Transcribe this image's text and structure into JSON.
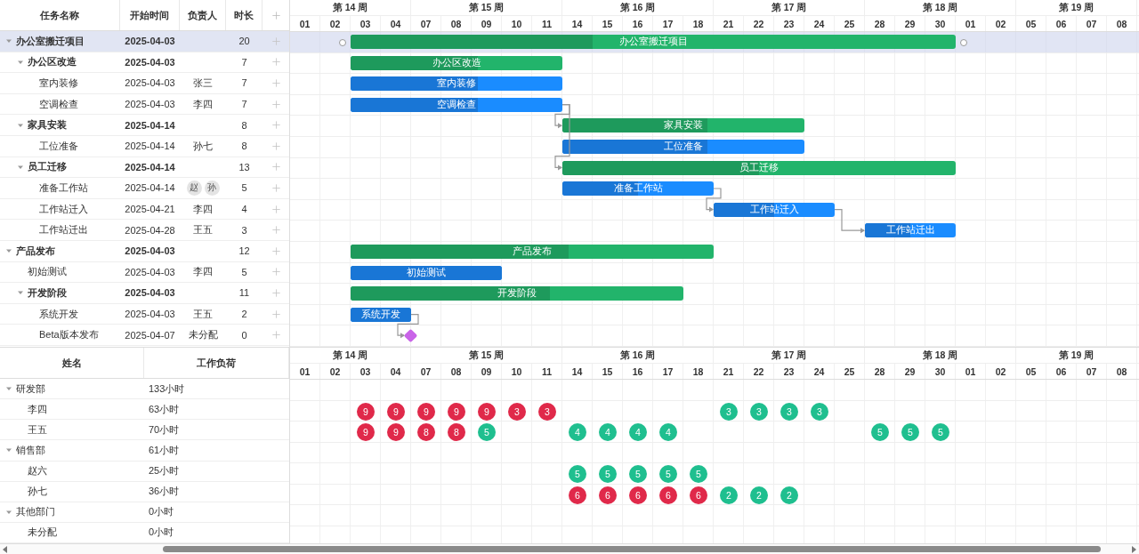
{
  "task_table": {
    "columns": [
      "任务名称",
      "开始时间",
      "负责人",
      "时长"
    ]
  },
  "timeline": {
    "weeks": [
      {
        "label": "第 14 周",
        "days": [
          "01",
          "02",
          "03",
          "04"
        ]
      },
      {
        "label": "第 15 周",
        "days": [
          "07",
          "08",
          "09",
          "10",
          "11"
        ]
      },
      {
        "label": "第 16 周",
        "days": [
          "14",
          "15",
          "16",
          "17",
          "18"
        ]
      },
      {
        "label": "第 17 周",
        "days": [
          "21",
          "22",
          "23",
          "24",
          "25"
        ]
      },
      {
        "label": "第 18 周",
        "days": [
          "28",
          "29",
          "30",
          "01",
          "02"
        ]
      },
      {
        "label": "第 19 周",
        "days": [
          "05",
          "06",
          "07",
          "08"
        ]
      }
    ]
  },
  "tasks": [
    {
      "name": "办公室搬迁项目",
      "start": "2025-04-03",
      "duration": "20",
      "bar_label": "办公室搬迁项目",
      "level": 0.4,
      "selected": true,
      "expanded": true,
      "children": [
        {
          "name": "办公区改造",
          "start": "2025-04-03",
          "duration": "7",
          "bar_label": "办公区改造",
          "level": 0.6,
          "selected": false,
          "expanded": true,
          "children": [
            {
              "name": "室内装修",
              "start": "2025-04-03",
              "assignee": "张三",
              "duration": "7",
              "bar_label": "室内装修",
              "level": 0.6,
              "selected": false
            },
            {
              "name": "空调检查",
              "start": "2025-04-03",
              "assignee": "李四",
              "duration": "7",
              "bar_label": "空调检查",
              "level": 0.6,
              "selected": false
            }
          ]
        },
        {
          "name": "家具安装",
          "start": "2025-04-14",
          "duration": "8",
          "bar_label": "家具安装",
          "level": 0.6,
          "selected": false,
          "expanded": true,
          "linked": true,
          "children": [
            {
              "name": "工位准备",
              "start": "2025-04-14",
              "assignee": "孙七",
              "duration": "8",
              "bar_label": "工位准备",
              "level": 0.6,
              "selected": false
            }
          ]
        },
        {
          "name": "员工迁移",
          "start": "2025-04-14",
          "duration": "13",
          "bar_label": "员工迁移",
          "level": 0.5,
          "selected": false,
          "expanded": true,
          "linked": true,
          "children": [
            {
              "name": "准备工作站",
              "start": "2025-04-14",
              "assignees": [
                "赵",
                "孙"
              ],
              "duration": "5",
              "bar_label": "准备工作站",
              "level": 0.5,
              "selected": false
            },
            {
              "name": "工作站迁入",
              "start": "2025-04-21",
              "assignee": "李四",
              "duration": "4",
              "bar_label": "工作站迁入",
              "level": 0.5,
              "selected": false,
              "linked": true
            },
            {
              "name": "工作站迁出",
              "start": "2025-04-28",
              "assignee": "王五",
              "duration": "3",
              "bar_label": "工作站迁出",
              "level": 0.5,
              "selected": false,
              "linked": true
            }
          ]
        }
      ]
    },
    {
      "name": "产品发布",
      "start": "2025-04-03",
      "duration": "12",
      "bar_label": "产品发布",
      "level": 0.6,
      "selected": false,
      "expanded": true,
      "children": [
        {
          "name": "初始测试",
          "start": "2025-04-03",
          "assignee": "李四",
          "duration": "5",
          "bar_label": "初始测试",
          "level": 1,
          "selected": false
        },
        {
          "name": "开发阶段",
          "start": "2025-04-03",
          "duration": "11",
          "bar_label": "开发阶段",
          "level": 0.6,
          "selected": false,
          "expanded": true,
          "children": [
            {
              "name": "系统开发",
              "start": "2025-04-03",
              "assignee": "王五",
              "duration": "2",
              "bar_label": "系统开发",
              "level": 1,
              "selected": false
            },
            {
              "name": "Beta版本发布",
              "start": "2025-04-07",
              "assignee": "未分配",
              "duration": "0",
              "selected": false,
              "linked": true
            }
          ]
        }
      ]
    }
  ],
  "resource_table": {
    "columns": [
      "姓名",
      "工作负荷"
    ]
  },
  "resource_timeline": {
    "weeks": [
      {
        "label": "第 14 周",
        "days": [
          "01",
          "02",
          "03",
          "04"
        ]
      },
      {
        "label": "第 15 周",
        "days": [
          "07",
          "08",
          "09",
          "10",
          "11"
        ]
      },
      {
        "label": "第 16 周",
        "days": [
          "14",
          "15",
          "16",
          "17",
          "18"
        ]
      },
      {
        "label": "第 17 周",
        "days": [
          "21",
          "22",
          "23",
          "24",
          "25"
        ]
      },
      {
        "label": "第 18 周",
        "days": [
          "28",
          "29",
          "30",
          "01",
          "02"
        ]
      },
      {
        "label": "第 19 周",
        "days": [
          "05",
          "06",
          "07",
          "08"
        ]
      }
    ]
  },
  "resources": [
    {
      "name": "研发部",
      "workload": "133小时",
      "expanded": true,
      "children": [
        {
          "name": "李四",
          "workload": "63小时",
          "loads": [
            {
              "kind": "empty"
            },
            {
              "kind": "empty"
            },
            {
              "kind": "load",
              "value": "9",
              "color": "#e0294a"
            },
            {
              "kind": "load",
              "value": "9",
              "color": "#e0294a"
            },
            {
              "kind": "load",
              "value": "9",
              "color": "#e0294a"
            },
            {
              "kind": "load",
              "value": "9",
              "color": "#e0294a"
            },
            {
              "kind": "load",
              "value": "9",
              "color": "#e0294a"
            },
            {
              "kind": "load",
              "value": "3",
              "color": "#e0294a"
            },
            {
              "kind": "load",
              "value": "3",
              "color": "#e0294a"
            },
            {
              "kind": "empty"
            },
            {
              "kind": "empty"
            },
            {
              "kind": "empty"
            },
            {
              "kind": "empty"
            },
            {
              "kind": "empty"
            },
            {
              "kind": "load",
              "value": "3",
              "color": "#1fbf8f"
            },
            {
              "kind": "load",
              "value": "3",
              "color": "#1fbf8f"
            },
            {
              "kind": "load",
              "value": "3",
              "color": "#1fbf8f"
            },
            {
              "kind": "load",
              "value": "3",
              "color": "#1fbf8f"
            }
          ]
        },
        {
          "name": "王五",
          "workload": "70小时",
          "loads": [
            {
              "kind": "empty"
            },
            {
              "kind": "empty"
            },
            {
              "kind": "load",
              "value": "9",
              "color": "#e0294a"
            },
            {
              "kind": "load",
              "value": "9",
              "color": "#e0294a"
            },
            {
              "kind": "load",
              "value": "8",
              "color": "#e0294a"
            },
            {
              "kind": "load",
              "value": "8",
              "color": "#e0294a"
            },
            {
              "kind": "load",
              "value": "5",
              "color": "#1fbf8f"
            },
            {
              "kind": "empty"
            },
            {
              "kind": "empty"
            },
            {
              "kind": "load",
              "value": "4",
              "color": "#1fbf8f"
            },
            {
              "kind": "load",
              "value": "4",
              "color": "#1fbf8f"
            },
            {
              "kind": "load",
              "value": "4",
              "color": "#1fbf8f"
            },
            {
              "kind": "load",
              "value": "4",
              "color": "#1fbf8f"
            },
            {
              "kind": "empty"
            },
            {
              "kind": "empty"
            },
            {
              "kind": "empty"
            },
            {
              "kind": "empty"
            },
            {
              "kind": "empty"
            },
            {
              "kind": "empty"
            },
            {
              "kind": "load",
              "value": "5",
              "color": "#1fbf8f"
            },
            {
              "kind": "load",
              "value": "5",
              "color": "#1fbf8f"
            },
            {
              "kind": "load",
              "value": "5",
              "color": "#1fbf8f"
            }
          ]
        }
      ]
    },
    {
      "name": "销售部",
      "workload": "61小时",
      "expanded": true,
      "children": [
        {
          "name": "赵六",
          "workload": "25小时",
          "loads": [
            {
              "kind": "empty"
            },
            {
              "kind": "empty"
            },
            {
              "kind": "empty"
            },
            {
              "kind": "empty"
            },
            {
              "kind": "empty"
            },
            {
              "kind": "empty"
            },
            {
              "kind": "empty"
            },
            {
              "kind": "empty"
            },
            {
              "kind": "empty"
            },
            {
              "kind": "load",
              "value": "5",
              "color": "#1fbf8f"
            },
            {
              "kind": "load",
              "value": "5",
              "color": "#1fbf8f"
            },
            {
              "kind": "load",
              "value": "5",
              "color": "#1fbf8f"
            },
            {
              "kind": "load",
              "value": "5",
              "color": "#1fbf8f"
            },
            {
              "kind": "load",
              "value": "5",
              "color": "#1fbf8f"
            }
          ]
        },
        {
          "name": "孙七",
          "workload": "36小时",
          "loads": [
            {
              "kind": "empty"
            },
            {
              "kind": "empty"
            },
            {
              "kind": "empty"
            },
            {
              "kind": "empty"
            },
            {
              "kind": "empty"
            },
            {
              "kind": "empty"
            },
            {
              "kind": "empty"
            },
            {
              "kind": "empty"
            },
            {
              "kind": "empty"
            },
            {
              "kind": "load",
              "value": "6",
              "color": "#e0294a"
            },
            {
              "kind": "load",
              "value": "6",
              "color": "#e0294a"
            },
            {
              "kind": "load",
              "value": "6",
              "color": "#e0294a"
            },
            {
              "kind": "load",
              "value": "6",
              "color": "#e0294a"
            },
            {
              "kind": "load",
              "value": "6",
              "color": "#e0294a"
            },
            {
              "kind": "load",
              "value": "2",
              "color": "#1fbf8f"
            },
            {
              "kind": "load",
              "value": "2",
              "color": "#1fbf8f"
            },
            {
              "kind": "load",
              "value": "2",
              "color": "#1fbf8f"
            }
          ]
        }
      ]
    },
    {
      "name": "其他部门",
      "workload": "0小时",
      "expanded": true,
      "children": [
        {
          "name": "未分配",
          "workload": "0小时"
        }
      ]
    }
  ]
}
